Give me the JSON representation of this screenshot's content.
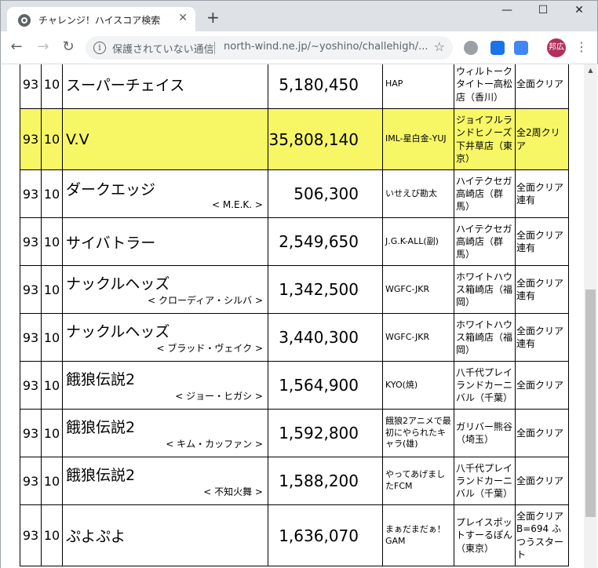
{
  "browser": {
    "tab_title": "チャレンジ！ハイスコア検索",
    "tab_close": "✕",
    "new_tab": "+",
    "min": "—",
    "max": "☐",
    "close": "✕",
    "back": "←",
    "forward": "→",
    "reload": "↻",
    "security_text": "保護されていない通信",
    "url": "north-wind.ne.jp/~yoshino/challehigh/...",
    "star": "☆",
    "avatar_text": "邦広",
    "menu": "⋮",
    "info": "i"
  },
  "table": {
    "rows": [
      {
        "lv": "93",
        "stage": "10",
        "game": "スーパーチェイス",
        "sub": "",
        "score": "5,180,450",
        "player": "HAP",
        "shop": "ウィルトークタイトー高松店（香川）",
        "note": "全面クリア",
        "highlight": false
      },
      {
        "lv": "93",
        "stage": "10",
        "game": "V.V",
        "sub": "",
        "score": "35,808,140",
        "player": "IML-星白金-YUJ",
        "shop": "ジョイフルランドヒノーズ下井草店（東京）",
        "note": "全2周クリア",
        "highlight": true
      },
      {
        "lv": "93",
        "stage": "10",
        "game": "ダークエッジ",
        "sub": "< M.E.K. >",
        "score": "506,300",
        "player": "いせえび勘太",
        "shop": "ハイテクセガ高崎店（群馬）",
        "note": "全面クリア連有",
        "highlight": false
      },
      {
        "lv": "93",
        "stage": "10",
        "game": "サイバトラー",
        "sub": "",
        "score": "2,549,650",
        "player": "J.G.K-ALL(副)",
        "shop": "ハイテクセガ高崎店（群馬）",
        "note": "全面クリア連有",
        "highlight": false
      },
      {
        "lv": "93",
        "stage": "10",
        "game": "ナックルヘッズ",
        "sub": "< クローディア・シルバ >",
        "score": "1,342,500",
        "player": "WGFC-JKR",
        "shop": "ホワイトハウス箱崎店（福岡）",
        "note": "全面クリア連有",
        "highlight": false
      },
      {
        "lv": "93",
        "stage": "10",
        "game": "ナックルヘッズ",
        "sub": "< ブラッド・ヴェイク >",
        "score": "3,440,300",
        "player": "WGFC-JKR",
        "shop": "ホワイトハウス箱崎店（福岡）",
        "note": "全面クリア連有",
        "highlight": false
      },
      {
        "lv": "93",
        "stage": "10",
        "game": "餓狼伝説2",
        "sub": "< ジョー・ヒガシ >",
        "score": "1,564,900",
        "player": "KYO(焼)",
        "shop": "八千代プレイランドカーニバル（千葉）",
        "note": "全面クリア",
        "highlight": false
      },
      {
        "lv": "93",
        "stage": "10",
        "game": "餓狼伝説2",
        "sub": "< キム・カッファン >",
        "score": "1,592,800",
        "player": "餓狼2アニメで最初にやられたキャラ(雄)",
        "shop": "ガリバー熊谷（埼玉）",
        "note": "全面クリア",
        "highlight": false
      },
      {
        "lv": "93",
        "stage": "10",
        "game": "餓狼伝説2",
        "sub": "< 不知火舞 >",
        "score": "1,588,200",
        "player": "やってあげましたFCM",
        "shop": "八千代プレイランドカーニバル（千葉）",
        "note": "全面クリア",
        "highlight": false
      },
      {
        "lv": "93",
        "stage": "10",
        "game": "ぷよぷよ",
        "sub": "",
        "score": "1,636,070",
        "player": "まぁだまだぁ！GAM",
        "shop": "プレイスポットすーるぽん（東京）",
        "note": "全面クリアB=694 ふつうスタート",
        "highlight": false
      }
    ]
  }
}
